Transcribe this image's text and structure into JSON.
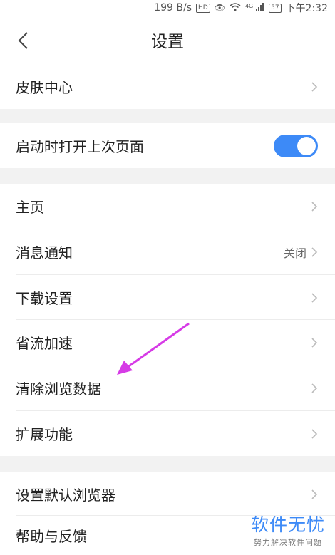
{
  "status_bar": {
    "speed": "199 B/s",
    "hd": "HD",
    "network": "4G",
    "battery": "57",
    "time": "下午2:32"
  },
  "header": {
    "title": "设置"
  },
  "sections": {
    "skin": "皮肤中心",
    "restore": "启动时打开上次页面",
    "home": "主页",
    "notify": "消息通知",
    "notify_value": "关闭",
    "download": "下载设置",
    "saver": "省流加速",
    "clear": "清除浏览数据",
    "extensions": "扩展功能",
    "default_browser": "设置默认浏览器",
    "help": "帮助与反馈"
  },
  "toggle": {
    "restore_on": true
  },
  "colors": {
    "accent": "#3d8af7",
    "annotation_arrow": "#d63be6",
    "gap_bg": "#f2f2f2"
  },
  "watermark": {
    "main": "软件无忧",
    "sub": "努力解决软件问题"
  }
}
